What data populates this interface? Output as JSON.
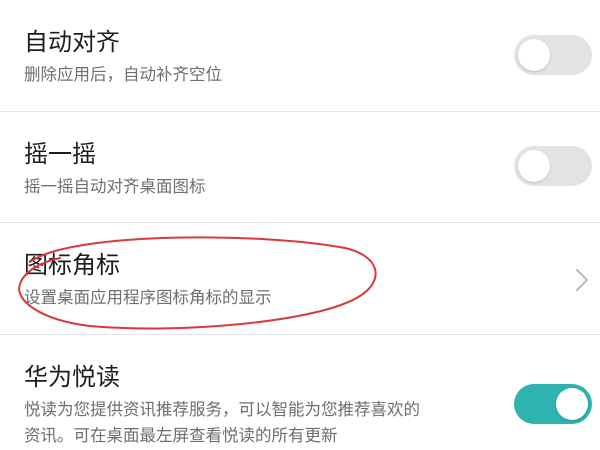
{
  "settings": [
    {
      "title": "自动对齐",
      "description": "删除应用后，自动补齐空位",
      "control": "toggle",
      "enabled": false
    },
    {
      "title": "摇一摇",
      "description": "摇一摇自动对齐桌面图标",
      "control": "toggle",
      "enabled": false
    },
    {
      "title": "图标角标",
      "description": "设置桌面应用程序图标角标的显示",
      "control": "chevron-right-icon"
    },
    {
      "title": "华为悦读",
      "description_lines": [
        "悦读为您提供资讯推荐服务，可以智能为您推荐喜欢的",
        "资讯。可在桌面最左屏查看悦读的所有更新"
      ],
      "control": "toggle",
      "enabled": true
    }
  ],
  "colors": {
    "toggle_on": "#2fb3b0",
    "toggle_off": "#e3e3e3",
    "annotation": "#d63a3a"
  }
}
